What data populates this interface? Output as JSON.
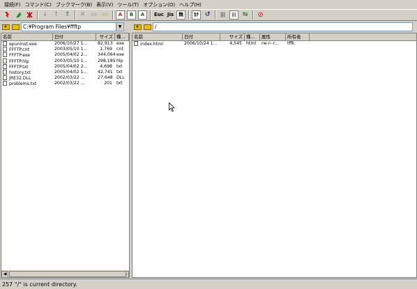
{
  "menu": [
    "接続(F)",
    "コマンド(C)",
    "ブックマーク(B)",
    "表示(V)",
    "ツール(T)",
    "オプション(O)",
    "ヘルプ(H)"
  ],
  "toolbar": {
    "connect_icon": "connect-icon",
    "quick_connect_icon": "quick-connect-icon",
    "disconnect_icon": "disconnect-icon",
    "download_label": "↓",
    "upload_label": "↑",
    "mirror_label": "⇑",
    "delete_label": "✕",
    "rename_label": "▭",
    "mkdir_label": "▭",
    "ascii_label": "A",
    "binary_label": "B",
    "auto_label": "A",
    "euc_label": "Euc",
    "jis_label": "Jis",
    "no_conv_label": "無",
    "kana_label": "ｶﾅ",
    "refresh_label": "↺",
    "list_label": "|||",
    "detail_label": "|||",
    "sync_label": "⇆",
    "stop_label": "⊘"
  },
  "local": {
    "path": "C:¥Program Files¥ffftp",
    "columns": [
      "名前",
      "日付",
      "サイズ",
      "種..."
    ],
    "files": [
      {
        "name": "epuninst.exe",
        "date": "2006/10/27 1...",
        "size": "82,913",
        "type": "exe"
      },
      {
        "name": "FFFTP.cnt",
        "date": "2003/05/10 1...",
        "size": "1,769",
        "type": "cnt"
      },
      {
        "name": "FFFTP.exe",
        "date": "2005/04/02 2...",
        "size": "344,064",
        "type": "exe"
      },
      {
        "name": "FFFTP.hlp",
        "date": "2003/05/10 1...",
        "size": "298,185",
        "type": "hlp"
      },
      {
        "name": "FFFTP.txt",
        "date": "2005/04/02 2...",
        "size": "4,698",
        "type": "txt"
      },
      {
        "name": "history.txt",
        "date": "2005/04/02 1...",
        "size": "42,741",
        "type": "txt"
      },
      {
        "name": "JRE32.DLL",
        "date": "2002/03/22 ...",
        "size": "27,648",
        "type": "DLL"
      },
      {
        "name": "problems.txt",
        "date": "2002/03/22 ...",
        "size": "201",
        "type": "txt"
      }
    ]
  },
  "remote": {
    "path": "/",
    "columns": [
      "名前",
      "日付",
      "サイズ",
      "種...",
      "属性",
      "所有者"
    ],
    "files": [
      {
        "name": "index.html",
        "date": "2006/10/24 1...",
        "size": "4,545",
        "type": "html",
        "attr": "rw-r--r...",
        "owner": "tffk"
      }
    ]
  },
  "status": "257 \"/\" is current directory."
}
